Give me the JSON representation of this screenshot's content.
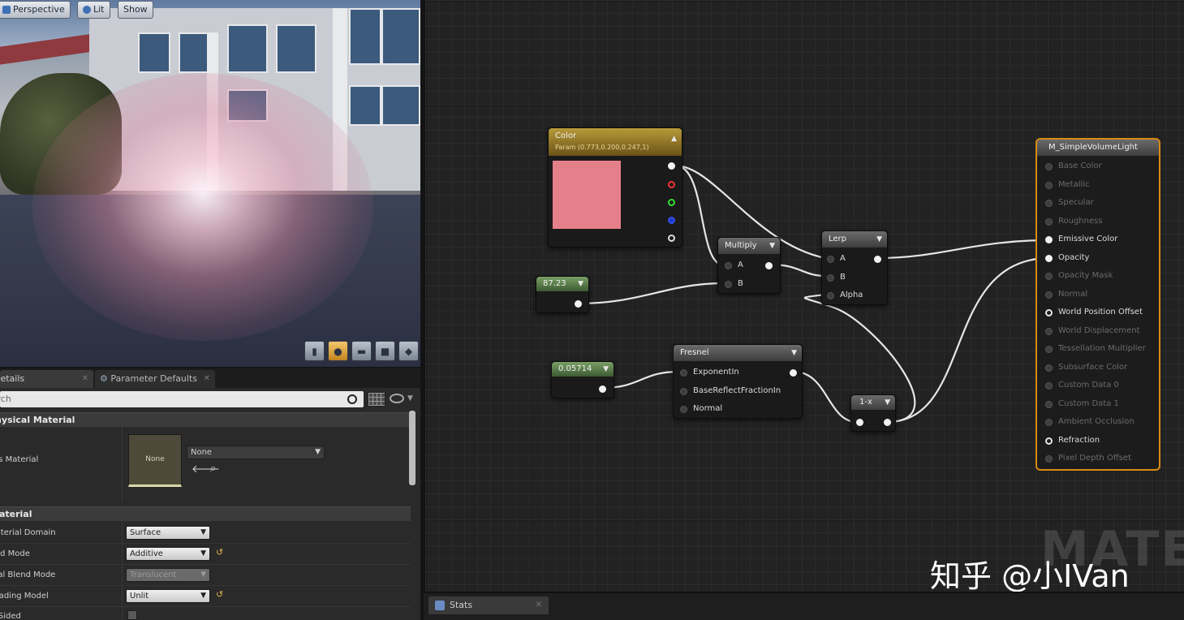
{
  "viewport": {
    "perspective_label": "Perspective",
    "lit_label": "Lit",
    "show_label": "Show"
  },
  "details": {
    "tabs": [
      {
        "label": "Details"
      },
      {
        "label": "Parameter Defaults"
      }
    ],
    "search_placeholder": "Search",
    "categories": {
      "physical_material": "Physical Material",
      "material": "Material"
    },
    "phys_material": {
      "label": "Phys Material",
      "thumb_text": "None",
      "value": "None"
    },
    "props": [
      {
        "label": "Material Domain",
        "value": "Surface"
      },
      {
        "label": "Blend Mode",
        "value": "Additive"
      },
      {
        "label": "Decal Blend Mode",
        "value": "Translucent"
      },
      {
        "label": "Shading Model",
        "value": "Unlit"
      },
      {
        "label": "Two Sided"
      }
    ]
  },
  "graph": {
    "color_node": {
      "title": "Color",
      "subtitle": "Param (0.773,0.200,0.247,1)"
    },
    "const1": {
      "value": "87.23"
    },
    "const2": {
      "value": "0.05714"
    },
    "multiply": {
      "title": "Multiply",
      "pin_a": "A",
      "pin_b": "B"
    },
    "lerp": {
      "title": "Lerp",
      "pin_a": "A",
      "pin_b": "B",
      "pin_alpha": "Alpha"
    },
    "fresnel": {
      "title": "Fresnel",
      "pins": [
        "ExponentIn",
        "BaseReflectFractionIn",
        "Normal"
      ]
    },
    "oneminus": {
      "title": "1-x"
    },
    "result": {
      "title": "M_SimpleVolumeLight",
      "pins": [
        {
          "label": "Base Color",
          "active": false
        },
        {
          "label": "Metallic",
          "active": false
        },
        {
          "label": "Specular",
          "active": false
        },
        {
          "label": "Roughness",
          "active": false
        },
        {
          "label": "Emissive Color",
          "active": true
        },
        {
          "label": "Opacity",
          "active": true
        },
        {
          "label": "Opacity Mask",
          "active": false
        },
        {
          "label": "Normal",
          "active": false
        },
        {
          "label": "World Position Offset",
          "active": true
        },
        {
          "label": "World Displacement",
          "active": false
        },
        {
          "label": "Tessellation Multiplier",
          "active": false
        },
        {
          "label": "Subsurface Color",
          "active": false
        },
        {
          "label": "Custom Data 0",
          "active": false
        },
        {
          "label": "Custom Data 1",
          "active": false
        },
        {
          "label": "Ambient Occlusion",
          "active": false
        },
        {
          "label": "Refraction",
          "active": true
        },
        {
          "label": "Pixel Depth Offset",
          "active": false
        }
      ]
    },
    "watermark": "MATERIAL",
    "credit": "知乎 @小IVan"
  },
  "stats": {
    "tab_label": "Stats"
  },
  "colors": {
    "param_color": "#e57f89",
    "result_border": "#d98b12",
    "wire": "#e8e8e8"
  }
}
